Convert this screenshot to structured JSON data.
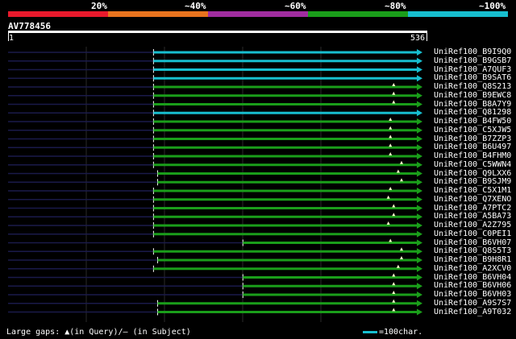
{
  "legend": {
    "percent_labels": [
      "20%",
      "~40%",
      "~60%",
      "~80%",
      "~100%"
    ],
    "colors": [
      "#e8192c",
      "#e8731e",
      "#a12da0",
      "#1a9e1a",
      "#17becf"
    ]
  },
  "query": {
    "id": "AV778456",
    "start": "1",
    "end": "536"
  },
  "hits": [
    {
      "name": "UniRef100_B9I9Q0",
      "color": "cyan",
      "start_frac": 0.353,
      "gaps": []
    },
    {
      "name": "UniRef100_B9GSB7",
      "color": "cyan",
      "start_frac": 0.353,
      "gaps": []
    },
    {
      "name": "UniRef100_A7QUF3",
      "color": "cyan",
      "start_frac": 0.353,
      "gaps": []
    },
    {
      "name": "UniRef100_B9SAT6",
      "color": "cyan",
      "start_frac": 0.353,
      "gaps": []
    },
    {
      "name": "UniRef100_Q8S213",
      "color": "green",
      "start_frac": 0.353,
      "gaps": [
        0.936
      ]
    },
    {
      "name": "UniRef100_B9EWC8",
      "color": "green",
      "start_frac": 0.353,
      "gaps": [
        0.936
      ]
    },
    {
      "name": "UniRef100_B8A7Y9",
      "color": "green",
      "start_frac": 0.353,
      "gaps": [
        0.936
      ]
    },
    {
      "name": "UniRef100_Q81298",
      "color": "cyan",
      "start_frac": 0.353,
      "gaps": []
    },
    {
      "name": "UniRef100_B4FW50",
      "color": "green",
      "start_frac": 0.353,
      "gaps": [
        0.928
      ]
    },
    {
      "name": "UniRef100_C5XJW5",
      "color": "green",
      "start_frac": 0.353,
      "gaps": [
        0.928
      ]
    },
    {
      "name": "UniRef100_B7ZZP3",
      "color": "green",
      "start_frac": 0.353,
      "gaps": [
        0.928
      ]
    },
    {
      "name": "UniRef100_B6U497",
      "color": "green",
      "start_frac": 0.353,
      "gaps": [
        0.928
      ]
    },
    {
      "name": "UniRef100_B4FHM0",
      "color": "green",
      "start_frac": 0.353,
      "gaps": [
        0.928
      ]
    },
    {
      "name": "UniRef100_C5WWN4",
      "color": "green",
      "start_frac": 0.353,
      "gaps": [
        0.955
      ]
    },
    {
      "name": "UniRef100_Q9LXX6",
      "color": "green",
      "start_frac": 0.363,
      "gaps": [
        0.947
      ]
    },
    {
      "name": "UniRef100_B9SJM9",
      "color": "green",
      "start_frac": 0.363,
      "gaps": [
        0.955
      ]
    },
    {
      "name": "UniRef100_C5X1M1",
      "color": "green",
      "start_frac": 0.353,
      "gaps": [
        0.928
      ]
    },
    {
      "name": "UniRef100_Q7XENO",
      "color": "green",
      "start_frac": 0.353,
      "gaps": [
        0.923
      ]
    },
    {
      "name": "UniRef100_A7PTC2",
      "color": "green",
      "start_frac": 0.353,
      "gaps": [
        0.936
      ]
    },
    {
      "name": "UniRef100_A5BA73",
      "color": "green",
      "start_frac": 0.353,
      "gaps": [
        0.936
      ]
    },
    {
      "name": "UniRef100_A2Z795",
      "color": "green",
      "start_frac": 0.353,
      "gaps": [
        0.923
      ]
    },
    {
      "name": "UniRef100_C0PEI1",
      "color": "green",
      "start_frac": 0.353,
      "gaps": []
    },
    {
      "name": "UniRef100_B6VH07",
      "color": "green",
      "start_frac": 0.57,
      "gaps": [
        0.928
      ]
    },
    {
      "name": "UniRef100_Q8S5T3",
      "color": "green",
      "start_frac": 0.353,
      "gaps": [
        0.955
      ]
    },
    {
      "name": "UniRef100_B9H8R1",
      "color": "green",
      "start_frac": 0.363,
      "gaps": [
        0.955
      ]
    },
    {
      "name": "UniRef100_A2XCV0",
      "color": "green",
      "start_frac": 0.353,
      "gaps": [
        0.947
      ]
    },
    {
      "name": "UniRef100_B6VH04",
      "color": "green",
      "start_frac": 0.57,
      "gaps": [
        0.936
      ]
    },
    {
      "name": "UniRef100_B6VH06",
      "color": "green",
      "start_frac": 0.57,
      "gaps": [
        0.936
      ]
    },
    {
      "name": "UniRef100_B6VH03",
      "color": "green",
      "start_frac": 0.57,
      "gaps": [
        0.936
      ]
    },
    {
      "name": "UniRef100_A9S7S7",
      "color": "green",
      "start_frac": 0.363,
      "gaps": [
        0.936
      ]
    },
    {
      "name": "UniRef100_A9T032",
      "color": "green",
      "start_frac": 0.363,
      "gaps": [
        0.936
      ]
    }
  ],
  "footer": {
    "large_gaps_text": "Large gaps: ▲(in Query)/– (in Subject)",
    "scale_text": "=100char."
  }
}
